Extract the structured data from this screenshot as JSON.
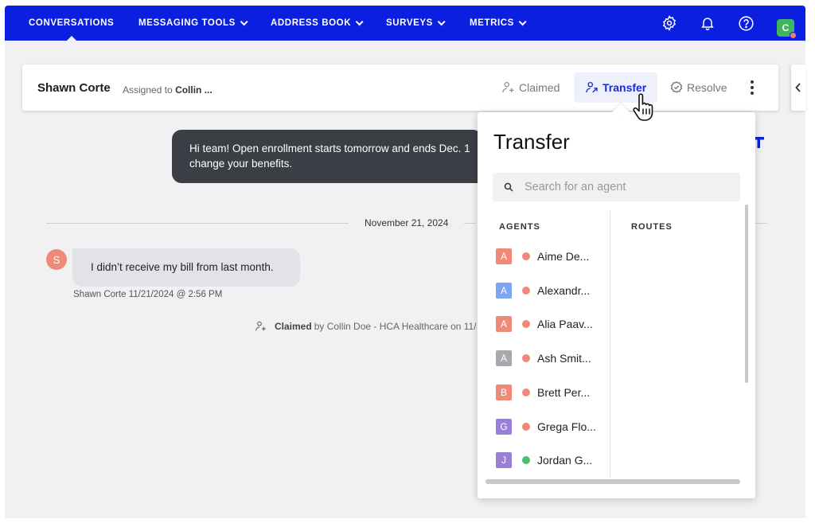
{
  "nav": {
    "items": [
      {
        "label": "CONVERSATIONS",
        "dropdown": false
      },
      {
        "label": "MESSAGING TOOLS",
        "dropdown": true
      },
      {
        "label": "ADDRESS BOOK",
        "dropdown": true
      },
      {
        "label": "SURVEYS",
        "dropdown": true
      },
      {
        "label": "METRICS",
        "dropdown": true
      }
    ],
    "icons": [
      "gear-icon",
      "bell-icon",
      "help-icon"
    ],
    "user_initial": "C",
    "brand_color": "#0a1fe0"
  },
  "conversation": {
    "name": "Shawn Corte",
    "assigned_prefix": "Assigned to",
    "assigned_to": "Collin ...",
    "actions": {
      "claimed": "Claimed",
      "transfer": "Transfer",
      "resolve": "Resolve"
    }
  },
  "messages": {
    "outgoing_line1": "Hi team! Open enrollment starts tomorrow and ends Dec. 1",
    "outgoing_line2": "change your benefits.",
    "date_divider": "November 21, 2024",
    "incoming_avatar": "S",
    "incoming_text": "I didn’t receive my bill from last month.",
    "incoming_meta_name": "Shawn Corte",
    "incoming_meta_time": "11/21/2024 @ 2:56 PM",
    "claimed_label": "Claimed",
    "claimed_text": "by Collin Doe - HCA Healthcare on 11/"
  },
  "transfer_popup": {
    "title": "Transfer",
    "search_placeholder": "Search for an agent",
    "agents_header": "AGENTS",
    "routes_header": "ROUTES",
    "agents": [
      {
        "initial": "A",
        "name": "Aime De...",
        "color": "#f08a78",
        "status": "#f08a78"
      },
      {
        "initial": "A",
        "name": "Alexandr...",
        "color": "#7aa6f2",
        "status": "#f08a78"
      },
      {
        "initial": "A",
        "name": "Alia Paav...",
        "color": "#f08a78",
        "status": "#f08a78"
      },
      {
        "initial": "A",
        "name": "Ash Smit...",
        "color": "#a9a9ad",
        "status": "#f08a78"
      },
      {
        "initial": "B",
        "name": "Brett Per...",
        "color": "#f08a78",
        "status": "#f08a78"
      },
      {
        "initial": "G",
        "name": "Grega Flo...",
        "color": "#9b7fd6",
        "status": "#f08a78"
      },
      {
        "initial": "J",
        "name": "Jordan G...",
        "color": "#9b7fd6",
        "status": "#4cbe6c"
      }
    ]
  }
}
